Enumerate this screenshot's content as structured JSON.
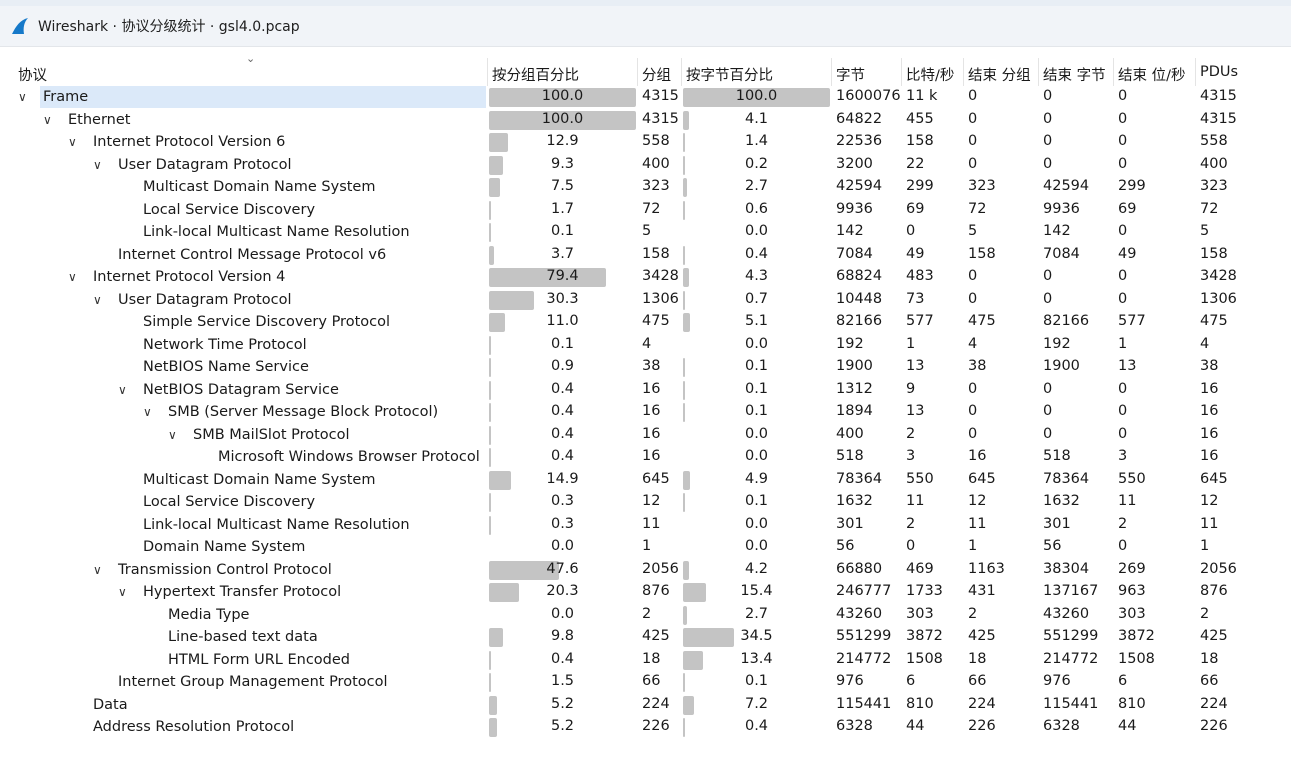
{
  "window": {
    "title": "Wireshark · 协议分级统计 · gsl4.0.pcap"
  },
  "columns": {
    "protocol": "协议",
    "pct_packets": "按分组百分比",
    "packets": "分组",
    "pct_bytes": "按字节百分比",
    "bytes": "字节",
    "bits_per_sec": "比特/秒",
    "end_packets": "结束 分组",
    "end_bytes": "结束 字节",
    "end_bits": "结束 位/秒",
    "pdus": "PDUs"
  },
  "rows": [
    {
      "name": "Frame",
      "depth": 0,
      "expander": "v",
      "pct_pkts": "100.0",
      "pkts": "4315",
      "pct_bytes": "100.0",
      "bytes": "1600076",
      "bps": "11 k",
      "end_pkts": "0",
      "end_bytes": "0",
      "end_bps": "0",
      "pdus": "4315",
      "selected": true
    },
    {
      "name": "Ethernet",
      "depth": 1,
      "expander": "v",
      "pct_pkts": "100.0",
      "pkts": "4315",
      "pct_bytes": "4.1",
      "bytes": "64822",
      "bps": "455",
      "end_pkts": "0",
      "end_bytes": "0",
      "end_bps": "0",
      "pdus": "4315"
    },
    {
      "name": "Internet Protocol Version 6",
      "depth": 2,
      "expander": "v",
      "pct_pkts": "12.9",
      "pkts": "558",
      "pct_bytes": "1.4",
      "bytes": "22536",
      "bps": "158",
      "end_pkts": "0",
      "end_bytes": "0",
      "end_bps": "0",
      "pdus": "558"
    },
    {
      "name": "User Datagram Protocol",
      "depth": 3,
      "expander": "v",
      "pct_pkts": "9.3",
      "pkts": "400",
      "pct_bytes": "0.2",
      "bytes": "3200",
      "bps": "22",
      "end_pkts": "0",
      "end_bytes": "0",
      "end_bps": "0",
      "pdus": "400"
    },
    {
      "name": "Multicast Domain Name System",
      "depth": 4,
      "expander": "",
      "pct_pkts": "7.5",
      "pkts": "323",
      "pct_bytes": "2.7",
      "bytes": "42594",
      "bps": "299",
      "end_pkts": "323",
      "end_bytes": "42594",
      "end_bps": "299",
      "pdus": "323"
    },
    {
      "name": "Local Service Discovery",
      "depth": 4,
      "expander": "",
      "pct_pkts": "1.7",
      "pkts": "72",
      "pct_bytes": "0.6",
      "bytes": "9936",
      "bps": "69",
      "end_pkts": "72",
      "end_bytes": "9936",
      "end_bps": "69",
      "pdus": "72"
    },
    {
      "name": "Link-local Multicast Name Resolution",
      "depth": 4,
      "expander": "",
      "pct_pkts": "0.1",
      "pkts": "5",
      "pct_bytes": "0.0",
      "bytes": "142",
      "bps": "0",
      "end_pkts": "5",
      "end_bytes": "142",
      "end_bps": "0",
      "pdus": "5"
    },
    {
      "name": "Internet Control Message Protocol v6",
      "depth": 3,
      "expander": "",
      "pct_pkts": "3.7",
      "pkts": "158",
      "pct_bytes": "0.4",
      "bytes": "7084",
      "bps": "49",
      "end_pkts": "158",
      "end_bytes": "7084",
      "end_bps": "49",
      "pdus": "158"
    },
    {
      "name": "Internet Protocol Version 4",
      "depth": 2,
      "expander": "v",
      "pct_pkts": "79.4",
      "pkts": "3428",
      "pct_bytes": "4.3",
      "bytes": "68824",
      "bps": "483",
      "end_pkts": "0",
      "end_bytes": "0",
      "end_bps": "0",
      "pdus": "3428"
    },
    {
      "name": "User Datagram Protocol",
      "depth": 3,
      "expander": "v",
      "pct_pkts": "30.3",
      "pkts": "1306",
      "pct_bytes": "0.7",
      "bytes": "10448",
      "bps": "73",
      "end_pkts": "0",
      "end_bytes": "0",
      "end_bps": "0",
      "pdus": "1306"
    },
    {
      "name": "Simple Service Discovery Protocol",
      "depth": 4,
      "expander": "",
      "pct_pkts": "11.0",
      "pkts": "475",
      "pct_bytes": "5.1",
      "bytes": "82166",
      "bps": "577",
      "end_pkts": "475",
      "end_bytes": "82166",
      "end_bps": "577",
      "pdus": "475"
    },
    {
      "name": "Network Time Protocol",
      "depth": 4,
      "expander": "",
      "pct_pkts": "0.1",
      "pkts": "4",
      "pct_bytes": "0.0",
      "bytes": "192",
      "bps": "1",
      "end_pkts": "4",
      "end_bytes": "192",
      "end_bps": "1",
      "pdus": "4"
    },
    {
      "name": "NetBIOS Name Service",
      "depth": 4,
      "expander": "",
      "pct_pkts": "0.9",
      "pkts": "38",
      "pct_bytes": "0.1",
      "bytes": "1900",
      "bps": "13",
      "end_pkts": "38",
      "end_bytes": "1900",
      "end_bps": "13",
      "pdus": "38"
    },
    {
      "name": "NetBIOS Datagram Service",
      "depth": 4,
      "expander": "v",
      "pct_pkts": "0.4",
      "pkts": "16",
      "pct_bytes": "0.1",
      "bytes": "1312",
      "bps": "9",
      "end_pkts": "0",
      "end_bytes": "0",
      "end_bps": "0",
      "pdus": "16"
    },
    {
      "name": "SMB (Server Message Block Protocol)",
      "depth": 5,
      "expander": "v",
      "pct_pkts": "0.4",
      "pkts": "16",
      "pct_bytes": "0.1",
      "bytes": "1894",
      "bps": "13",
      "end_pkts": "0",
      "end_bytes": "0",
      "end_bps": "0",
      "pdus": "16"
    },
    {
      "name": "SMB MailSlot Protocol",
      "depth": 6,
      "expander": "v",
      "pct_pkts": "0.4",
      "pkts": "16",
      "pct_bytes": "0.0",
      "bytes": "400",
      "bps": "2",
      "end_pkts": "0",
      "end_bytes": "0",
      "end_bps": "0",
      "pdus": "16"
    },
    {
      "name": "Microsoft Windows Browser Protocol",
      "depth": 7,
      "expander": "",
      "pct_pkts": "0.4",
      "pkts": "16",
      "pct_bytes": "0.0",
      "bytes": "518",
      "bps": "3",
      "end_pkts": "16",
      "end_bytes": "518",
      "end_bps": "3",
      "pdus": "16"
    },
    {
      "name": "Multicast Domain Name System",
      "depth": 4,
      "expander": "",
      "pct_pkts": "14.9",
      "pkts": "645",
      "pct_bytes": "4.9",
      "bytes": "78364",
      "bps": "550",
      "end_pkts": "645",
      "end_bytes": "78364",
      "end_bps": "550",
      "pdus": "645"
    },
    {
      "name": "Local Service Discovery",
      "depth": 4,
      "expander": "",
      "pct_pkts": "0.3",
      "pkts": "12",
      "pct_bytes": "0.1",
      "bytes": "1632",
      "bps": "11",
      "end_pkts": "12",
      "end_bytes": "1632",
      "end_bps": "11",
      "pdus": "12"
    },
    {
      "name": "Link-local Multicast Name Resolution",
      "depth": 4,
      "expander": "",
      "pct_pkts": "0.3",
      "pkts": "11",
      "pct_bytes": "0.0",
      "bytes": "301",
      "bps": "2",
      "end_pkts": "11",
      "end_bytes": "301",
      "end_bps": "2",
      "pdus": "11"
    },
    {
      "name": "Domain Name System",
      "depth": 4,
      "expander": "",
      "pct_pkts": "0.0",
      "pkts": "1",
      "pct_bytes": "0.0",
      "bytes": "56",
      "bps": "0",
      "end_pkts": "1",
      "end_bytes": "56",
      "end_bps": "0",
      "pdus": "1"
    },
    {
      "name": "Transmission Control Protocol",
      "depth": 3,
      "expander": "v",
      "pct_pkts": "47.6",
      "pkts": "2056",
      "pct_bytes": "4.2",
      "bytes": "66880",
      "bps": "469",
      "end_pkts": "1163",
      "end_bytes": "38304",
      "end_bps": "269",
      "pdus": "2056"
    },
    {
      "name": "Hypertext Transfer Protocol",
      "depth": 4,
      "expander": "v",
      "pct_pkts": "20.3",
      "pkts": "876",
      "pct_bytes": "15.4",
      "bytes": "246777",
      "bps": "1733",
      "end_pkts": "431",
      "end_bytes": "137167",
      "end_bps": "963",
      "pdus": "876"
    },
    {
      "name": "Media Type",
      "depth": 5,
      "expander": "",
      "pct_pkts": "0.0",
      "pkts": "2",
      "pct_bytes": "2.7",
      "bytes": "43260",
      "bps": "303",
      "end_pkts": "2",
      "end_bytes": "43260",
      "end_bps": "303",
      "pdus": "2"
    },
    {
      "name": "Line-based text data",
      "depth": 5,
      "expander": "",
      "pct_pkts": "9.8",
      "pkts": "425",
      "pct_bytes": "34.5",
      "bytes": "551299",
      "bps": "3872",
      "end_pkts": "425",
      "end_bytes": "551299",
      "end_bps": "3872",
      "pdus": "425"
    },
    {
      "name": "HTML Form URL Encoded",
      "depth": 5,
      "expander": "",
      "pct_pkts": "0.4",
      "pkts": "18",
      "pct_bytes": "13.4",
      "bytes": "214772",
      "bps": "1508",
      "end_pkts": "18",
      "end_bytes": "214772",
      "end_bps": "1508",
      "pdus": "18"
    },
    {
      "name": "Internet Group Management Protocol",
      "depth": 3,
      "expander": "",
      "pct_pkts": "1.5",
      "pkts": "66",
      "pct_bytes": "0.1",
      "bytes": "976",
      "bps": "6",
      "end_pkts": "66",
      "end_bytes": "976",
      "end_bps": "6",
      "pdus": "66"
    },
    {
      "name": "Data",
      "depth": 2,
      "expander": "",
      "pct_pkts": "5.2",
      "pkts": "224",
      "pct_bytes": "7.2",
      "bytes": "115441",
      "bps": "810",
      "end_pkts": "224",
      "end_bytes": "115441",
      "end_bps": "810",
      "pdus": "224"
    },
    {
      "name": "Address Resolution Protocol",
      "depth": 2,
      "expander": "",
      "pct_pkts": "5.2",
      "pkts": "226",
      "pct_bytes": "0.4",
      "bytes": "6328",
      "bps": "44",
      "end_pkts": "226",
      "end_bytes": "6328",
      "end_bps": "44",
      "pdus": "226"
    }
  ],
  "colors": {
    "bar": "#c4c4c4",
    "selected_row": "#dbe9f9",
    "titlebar": "#f1f4f8"
  },
  "icons": {
    "app": "wireshark-fin-icon",
    "expander": "chevron-down-icon",
    "sort": "sort-indicator-icon"
  }
}
